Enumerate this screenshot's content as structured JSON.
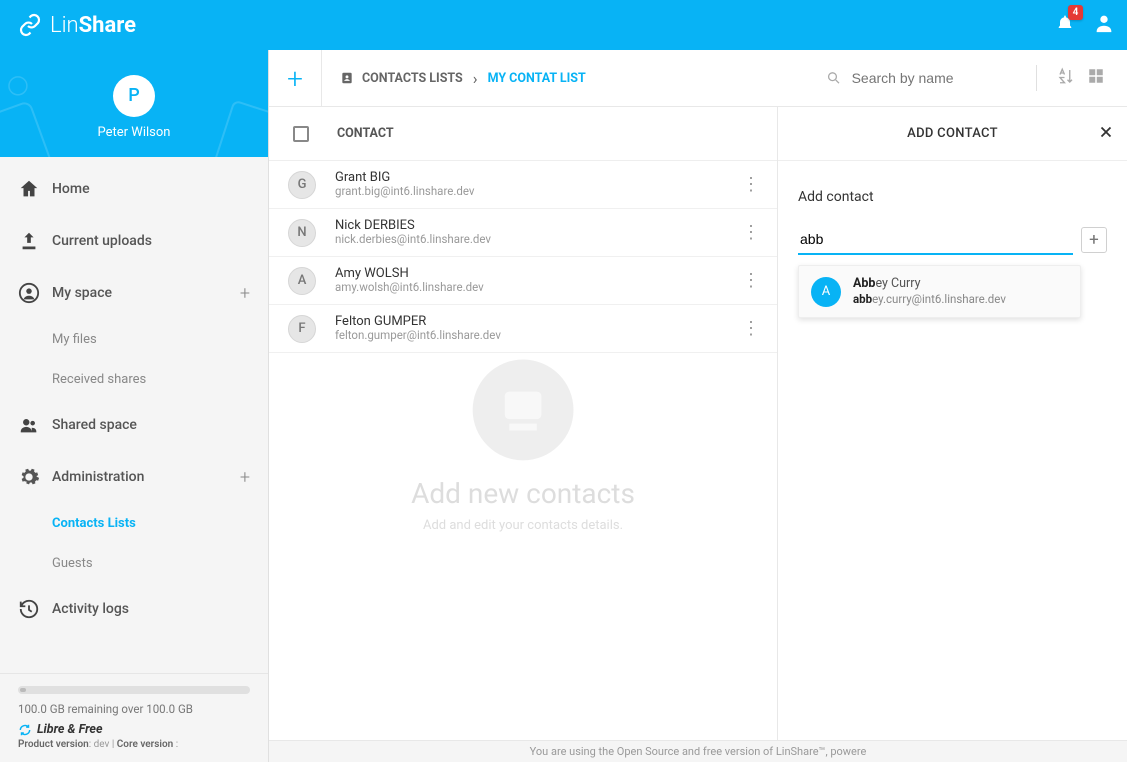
{
  "brand": {
    "prefix": "Lin",
    "suffix": "Share"
  },
  "header": {
    "notification_count": "4"
  },
  "profile": {
    "initial": "P",
    "name": "Peter Wilson"
  },
  "nav": {
    "home": "Home",
    "uploads": "Current uploads",
    "myspace": "My space",
    "myfiles": "My files",
    "received": "Received shares",
    "shared": "Shared space",
    "admin": "Administration",
    "contacts": "Contacts Lists",
    "guests": "Guests",
    "activity": "Activity logs"
  },
  "storage": {
    "text": "100.0 GB remaining over 100.0 GB",
    "libre": "Libre & Free",
    "product": "Product version",
    "dev": ": dev  |  ",
    "core": "Core version",
    "core_suffix": " :"
  },
  "toolbar": {
    "root": "CONTACTS LISTS",
    "current": "MY CONTAT LIST",
    "search_placeholder": "Search by name"
  },
  "list": {
    "header": "CONTACT",
    "rows": [
      {
        "initial": "G",
        "name": "Grant BIG",
        "email": "grant.big@int6.linshare.dev"
      },
      {
        "initial": "N",
        "name": "Nick DERBIES",
        "email": "nick.derbies@int6.linshare.dev"
      },
      {
        "initial": "A",
        "name": "Amy WOLSH",
        "email": "amy.wolsh@int6.linshare.dev"
      },
      {
        "initial": "F",
        "name": "Felton GUMPER",
        "email": "felton.gumper@int6.linshare.dev"
      }
    ]
  },
  "empty": {
    "title": "Add new contacts",
    "subtitle": "Add and edit your contacts details."
  },
  "panel": {
    "title": "ADD CONTACT",
    "label": "Add contact",
    "input_value": "abb",
    "suggestion": {
      "initial": "A",
      "name_bold": "Abb",
      "name_rest": "ey Curry",
      "email_bold": "abb",
      "email_rest": "ey.curry@int6.linshare.dev"
    }
  },
  "footer": "You are using the Open Source and free version of LinShare™, powere"
}
